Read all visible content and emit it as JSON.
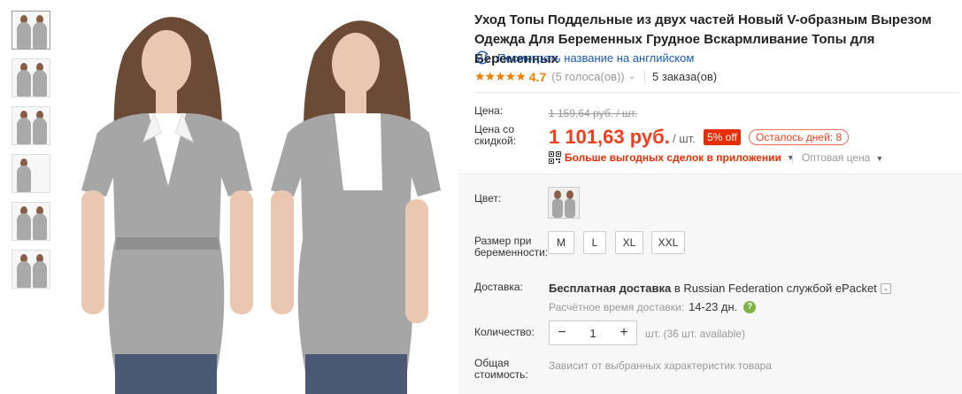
{
  "product": {
    "title": "Уход Топы Поддельные из двух частей Новый V-образным Вырезом Одежда Для Беременных Грудное Вскармливание Топы для Беременных",
    "translate_link": "Посмотреть название на английском",
    "stars": "★★★★★",
    "rating": "4.7",
    "votes": "(5 голоса(ов))",
    "orders": "5 заказа(ов)"
  },
  "price": {
    "price_label": "Цена:",
    "old_price": "1 159,64 руб. / шт.",
    "discount_label": "Цена со скидкой:",
    "new_price": "1 101,63 руб.",
    "per_unit": "/ шт.",
    "off_badge": "5% off",
    "days_left": "Осталось дней: 8",
    "app_deals": "Больше выгодных сделок в приложении",
    "wholesale": "Оптовая цена"
  },
  "options": {
    "color_label": "Цвет:",
    "size_label": "Размер при беременности:",
    "sizes": [
      "M",
      "L",
      "XL",
      "XXL"
    ]
  },
  "shipping": {
    "label": "Доставка:",
    "free": "Бесплатная доставка",
    "to_text": "в Russian Federation службой ePacket",
    "time_label": "Расчётное время доставки:",
    "time_value": "14-23 дн."
  },
  "quantity": {
    "label": "Количество:",
    "value": "1",
    "minus": "−",
    "plus": "+",
    "available": "шт. (36 шт. available)"
  },
  "total": {
    "label": "Общая стоимость:",
    "value": "Зависит от выбранных характеристик товара"
  },
  "colors": {
    "price_red": "#ee3e1b",
    "rating_orange": "#f57c00",
    "link_blue": "#1a5ab8"
  }
}
